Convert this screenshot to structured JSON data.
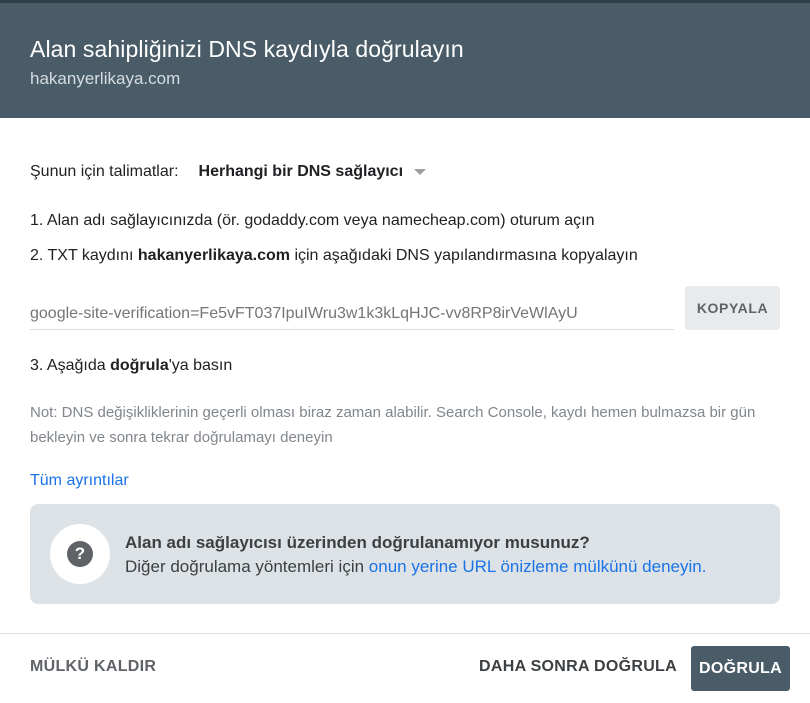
{
  "header": {
    "title": "Alan sahipliğinizi DNS kaydıyla doğrulayın",
    "subtitle": "hakanyerlikaya.com"
  },
  "instructions": {
    "label": "Şunun için talimatlar:",
    "provider_selected": "Herhangi bir DNS sağlayıcı"
  },
  "steps": {
    "step1": "1. Alan adı sağlayıcınızda (ör. godaddy.com veya namecheap.com) oturum açın",
    "step2_prefix": "2. TXT kaydını ",
    "step2_domain": "hakanyerlikaya.com",
    "step2_suffix": " için aşağıdaki DNS yapılandırmasına kopyalayın",
    "step3_prefix": "3. Aşağıda ",
    "step3_bold": "doğrula",
    "step3_suffix": "'ya basın"
  },
  "verification": {
    "record": "google-site-verification=Fe5vFT037IpuIWru3w1k3kLqHJC-vv8RP8irVeWlAyU",
    "copy_label": "KOPYALA"
  },
  "note": "Not: DNS değişikliklerinin geçerli olması biraz zaman alabilir. Search Console, kaydı hemen bulmazsa bir gün bekleyin ve sonra tekrar doğrulamayı deneyin",
  "details_link": "Tüm ayrıntılar",
  "help": {
    "icon": "?",
    "title": "Alan adı sağlayıcısı üzerinden doğrulanamıyor musunuz?",
    "body_prefix": "Diğer doğrulama yöntemleri için ",
    "body_link": "onun yerine URL önizleme mülkünü deneyin."
  },
  "footer": {
    "remove_label": "MÜLKÜ KALDIR",
    "later_label": "DAHA SONRA DOĞRULA",
    "verify_label": "DOĞRULA"
  },
  "colors": {
    "header_bg": "#4a5c67",
    "link": "#1a73e8",
    "help_bg": "#dde2e6",
    "primary_button": "#4a5c67"
  }
}
